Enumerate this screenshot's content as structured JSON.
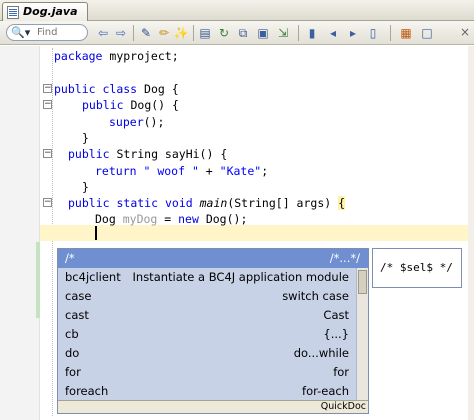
{
  "tab": {
    "title": "Dog.java"
  },
  "toolbar": {
    "find_placeholder": "Find",
    "buttons": [
      "back-icon",
      "forward-icon",
      "edit-icon",
      "highlight-icon",
      "wand-icon",
      "toggle-comment-icon",
      "refresh-icon",
      "compare-icon",
      "print-icon",
      "export-icon",
      "bookmark-icon",
      "prev-bookmark-icon",
      "next-bookmark-icon",
      "clear-bookmarks-icon",
      "split-icon",
      "window-icon"
    ],
    "close_glyph": "×"
  },
  "code": {
    "l1": {
      "kw": "package",
      "rest": " myproject;"
    },
    "l2": {
      "kw1": "public",
      "kw2": "class",
      "rest": " Dog {"
    },
    "l3": {
      "kw": "public",
      "rest": " Dog() {"
    },
    "l4": {
      "kw": "super",
      "rest": "();"
    },
    "l5": {
      "text": "}"
    },
    "l6": {
      "kw": "public",
      "rest": " String sayHi() {"
    },
    "l7": {
      "kw": "return",
      "s1": "\" woof \"",
      "plus": " + ",
      "s2": "\"Kate\"",
      "end": ";"
    },
    "l8": {
      "text": "}"
    },
    "l9": {
      "kw1": "public",
      "kw2": "static",
      "kw3": "void",
      "method": "main",
      "rest": "(String[] args) ",
      "brace": "{"
    },
    "l10": {
      "type": "Dog",
      "var": "myDog",
      "eq": " = ",
      "kw": "new",
      "rest": " Dog();"
    }
  },
  "popup": {
    "header_left": "/*",
    "header_right": "/*...*/",
    "items": [
      {
        "name": "bc4jclient",
        "desc": "Instantiate a BC4J application module"
      },
      {
        "name": "case",
        "desc": "switch case"
      },
      {
        "name": "cast",
        "desc": "Cast"
      },
      {
        "name": "cb",
        "desc": "{...}"
      },
      {
        "name": "do",
        "desc": "do...while"
      },
      {
        "name": "for",
        "desc": "for"
      },
      {
        "name": "foreach",
        "desc": "for-each"
      }
    ],
    "footer": "QuickDoc"
  },
  "doc_popup": {
    "text": "/* $sel$ */"
  },
  "colors": {
    "keyword": "#0000e6",
    "variable": "#999999",
    "popup_header": "#6f8fd0",
    "popup_bg": "#c7d2e7"
  }
}
